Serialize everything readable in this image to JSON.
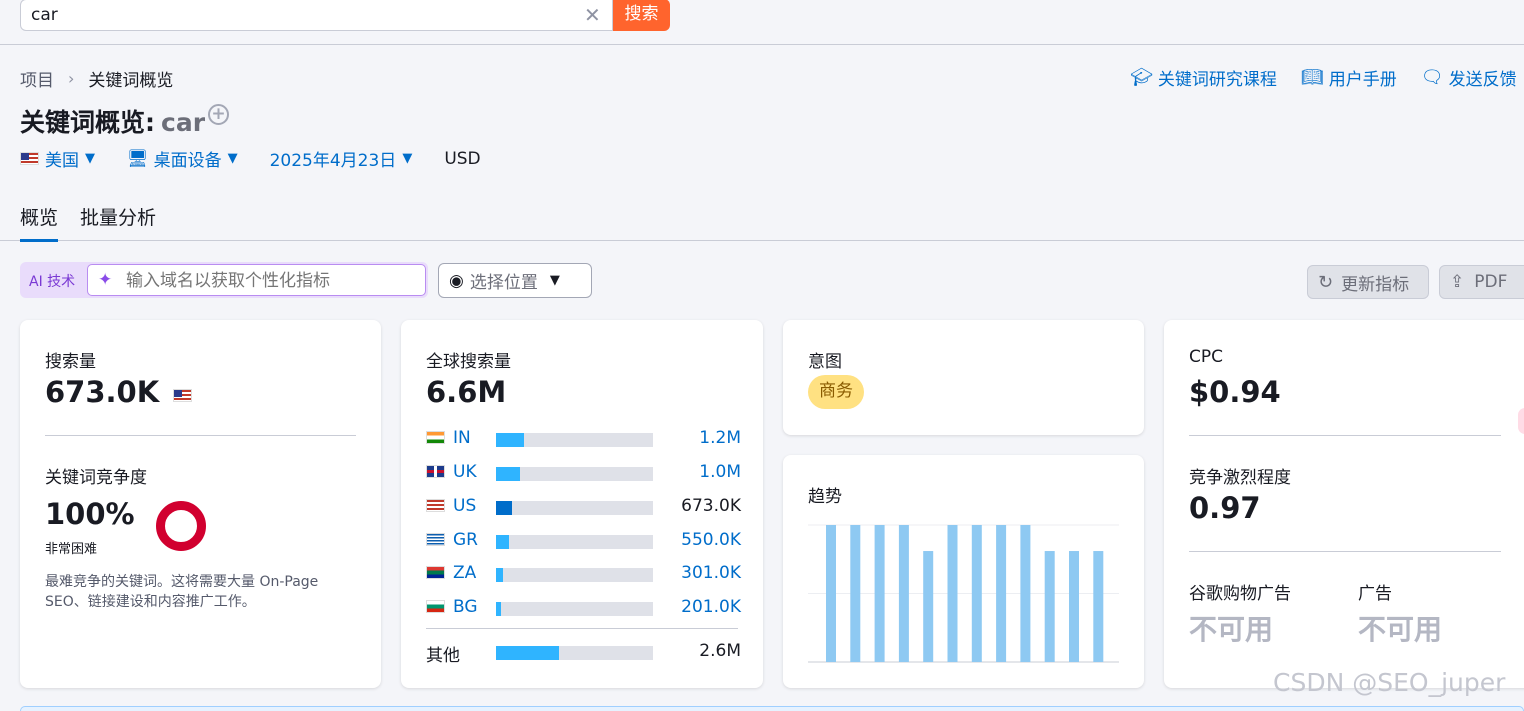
{
  "search": {
    "value": "car",
    "clear_icon": "close-icon",
    "button": "搜索"
  },
  "breadcrumb": {
    "root": "项目",
    "current": "关键词概览"
  },
  "toplinks": [
    {
      "label": "关键词研究课程",
      "icon": "graduation-cap-icon"
    },
    {
      "label": "用户手册",
      "icon": "book-icon"
    },
    {
      "label": "发送反馈",
      "icon": "feedback-icon"
    }
  ],
  "title": {
    "prefix": "关键词概览:",
    "keyword": "car"
  },
  "filters": {
    "country": "美国",
    "device": "桌面设备",
    "date": "2025年4月23日",
    "currency": "USD"
  },
  "tabs": [
    {
      "label": "概览",
      "active": true
    },
    {
      "label": "批量分析",
      "active": false
    }
  ],
  "ai": {
    "badge": "AI 技术",
    "placeholder": "输入域名以获取个性化指标"
  },
  "location": {
    "label": "选择位置"
  },
  "actions": {
    "refresh": "更新指标",
    "pdf": "PDF"
  },
  "volume_card": {
    "label": "搜索量",
    "value": "673.0K",
    "kd_label": "关键词竞争度",
    "kd_value": "100%",
    "kd_level": "非常困难",
    "kd_desc": "最难竞争的关键词。这将需要大量 On-Page SEO、链接建设和内容推广工作。",
    "kd_color": "#d1002f"
  },
  "global_card": {
    "label": "全球搜索量",
    "value": "6.6M",
    "countries": [
      {
        "code": "IN",
        "value": "1.2M",
        "share": 0.18
      },
      {
        "code": "UK",
        "value": "1.0M",
        "share": 0.15
      },
      {
        "code": "US",
        "value": "673.0K",
        "share": 0.1
      },
      {
        "code": "GR",
        "value": "550.0K",
        "share": 0.08
      },
      {
        "code": "ZA",
        "value": "301.0K",
        "share": 0.045
      },
      {
        "code": "BG",
        "value": "201.0K",
        "share": 0.03
      }
    ],
    "other": {
      "label": "其他",
      "value": "2.6M",
      "share": 0.4
    }
  },
  "intent_card": {
    "label": "意图",
    "badge": "商务"
  },
  "trend_card": {
    "label": "趋势",
    "chart_data": {
      "type": "bar",
      "values": [
        100,
        100,
        100,
        100,
        81,
        100,
        100,
        100,
        100,
        81,
        81,
        81
      ],
      "ylim": [
        0,
        100
      ]
    }
  },
  "cpc_card": {
    "label": "CPC",
    "value": "$0.94",
    "competition_label": "竞争激烈程度",
    "competition_value": "0.97",
    "shopping_label": "谷歌购物广告",
    "shopping_value": "不可用",
    "ads_label": "广告",
    "ads_value": "不可用"
  },
  "watermark": "CSDN @SEO_juper"
}
